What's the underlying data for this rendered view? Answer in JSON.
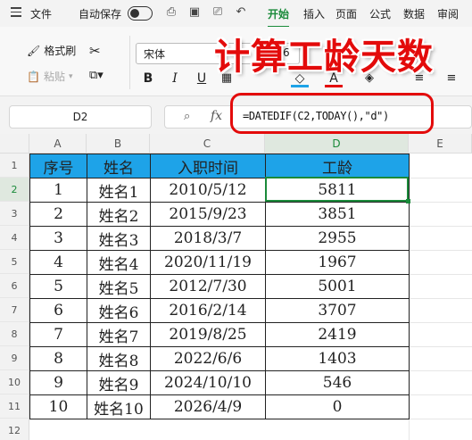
{
  "menubar": {
    "file_label": "文件",
    "autosave_label": "自动保存",
    "tabs": [
      "开始",
      "插入",
      "页面",
      "公式",
      "数据",
      "审阅"
    ],
    "active_tab": "开始"
  },
  "ribbon": {
    "format_painter_label": "格式刷",
    "paste_label": "粘贴",
    "font_name": "宋体",
    "font_size": "6",
    "bold": "B",
    "italic": "I",
    "underline": "U",
    "font_color_letter": "A",
    "fill_color": "#1ea3e8",
    "font_color": "#e30b0b"
  },
  "banner": {
    "text": "计算工龄天数"
  },
  "formulabar": {
    "cell_ref": "D2",
    "fx": "fx",
    "formula": "=DATEDIF(C2,TODAY(),\"d\")"
  },
  "grid": {
    "columns": [
      "A",
      "B",
      "C",
      "D",
      "E"
    ],
    "rows": [
      "1",
      "2",
      "3",
      "4",
      "5",
      "6",
      "7",
      "8",
      "9",
      "10",
      "11",
      "12"
    ],
    "selected_column": "D",
    "selected_row": "2",
    "header_fill": "#1ea3e8",
    "table": {
      "headers": [
        "序号",
        "姓名",
        "入职时间",
        "工龄"
      ],
      "rows": [
        [
          "1",
          "姓名1",
          "2010/5/12",
          "5811"
        ],
        [
          "2",
          "姓名2",
          "2015/9/23",
          "3851"
        ],
        [
          "3",
          "姓名3",
          "2018/3/7",
          "2955"
        ],
        [
          "4",
          "姓名4",
          "2020/11/19",
          "1967"
        ],
        [
          "5",
          "姓名5",
          "2012/7/30",
          "5001"
        ],
        [
          "6",
          "姓名6",
          "2016/2/14",
          "3707"
        ],
        [
          "7",
          "姓名7",
          "2019/8/25",
          "2419"
        ],
        [
          "8",
          "姓名8",
          "2022/6/6",
          "1403"
        ],
        [
          "9",
          "姓名9",
          "2024/10/10",
          "546"
        ],
        [
          "10",
          "姓名10",
          "2026/4/9",
          "0"
        ]
      ]
    }
  }
}
